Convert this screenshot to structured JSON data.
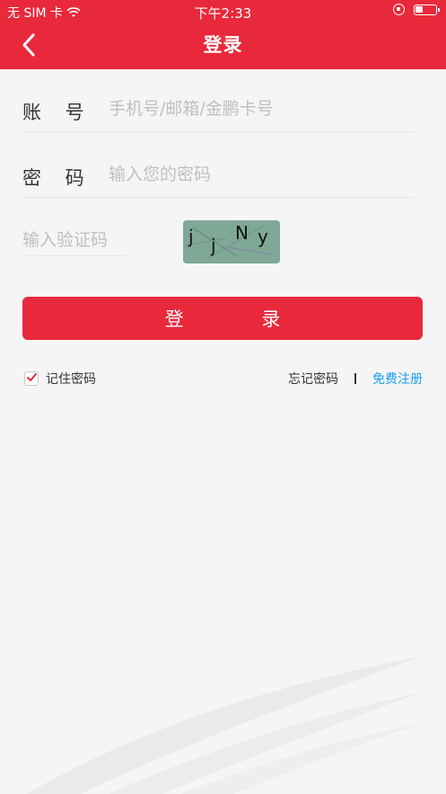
{
  "status_bar": {
    "carrier": "无 SIM 卡",
    "time": "下午2:33"
  },
  "nav": {
    "title": "登录"
  },
  "form": {
    "account_label": "账 号",
    "account_placeholder": "手机号/邮箱/金鹏卡号",
    "password_label": "密 码",
    "password_placeholder": "输入您的密码",
    "code_placeholder": "输入验证码",
    "captcha_chars": [
      "j",
      "j",
      "N",
      "y"
    ]
  },
  "login_button": "登 录",
  "remember_label": "记住密码",
  "remember_checked": true,
  "forgot_label": "忘记密码",
  "register_label": "免费注册",
  "colors": {
    "brand": "#e8293b",
    "link": "#1a9ef2"
  }
}
